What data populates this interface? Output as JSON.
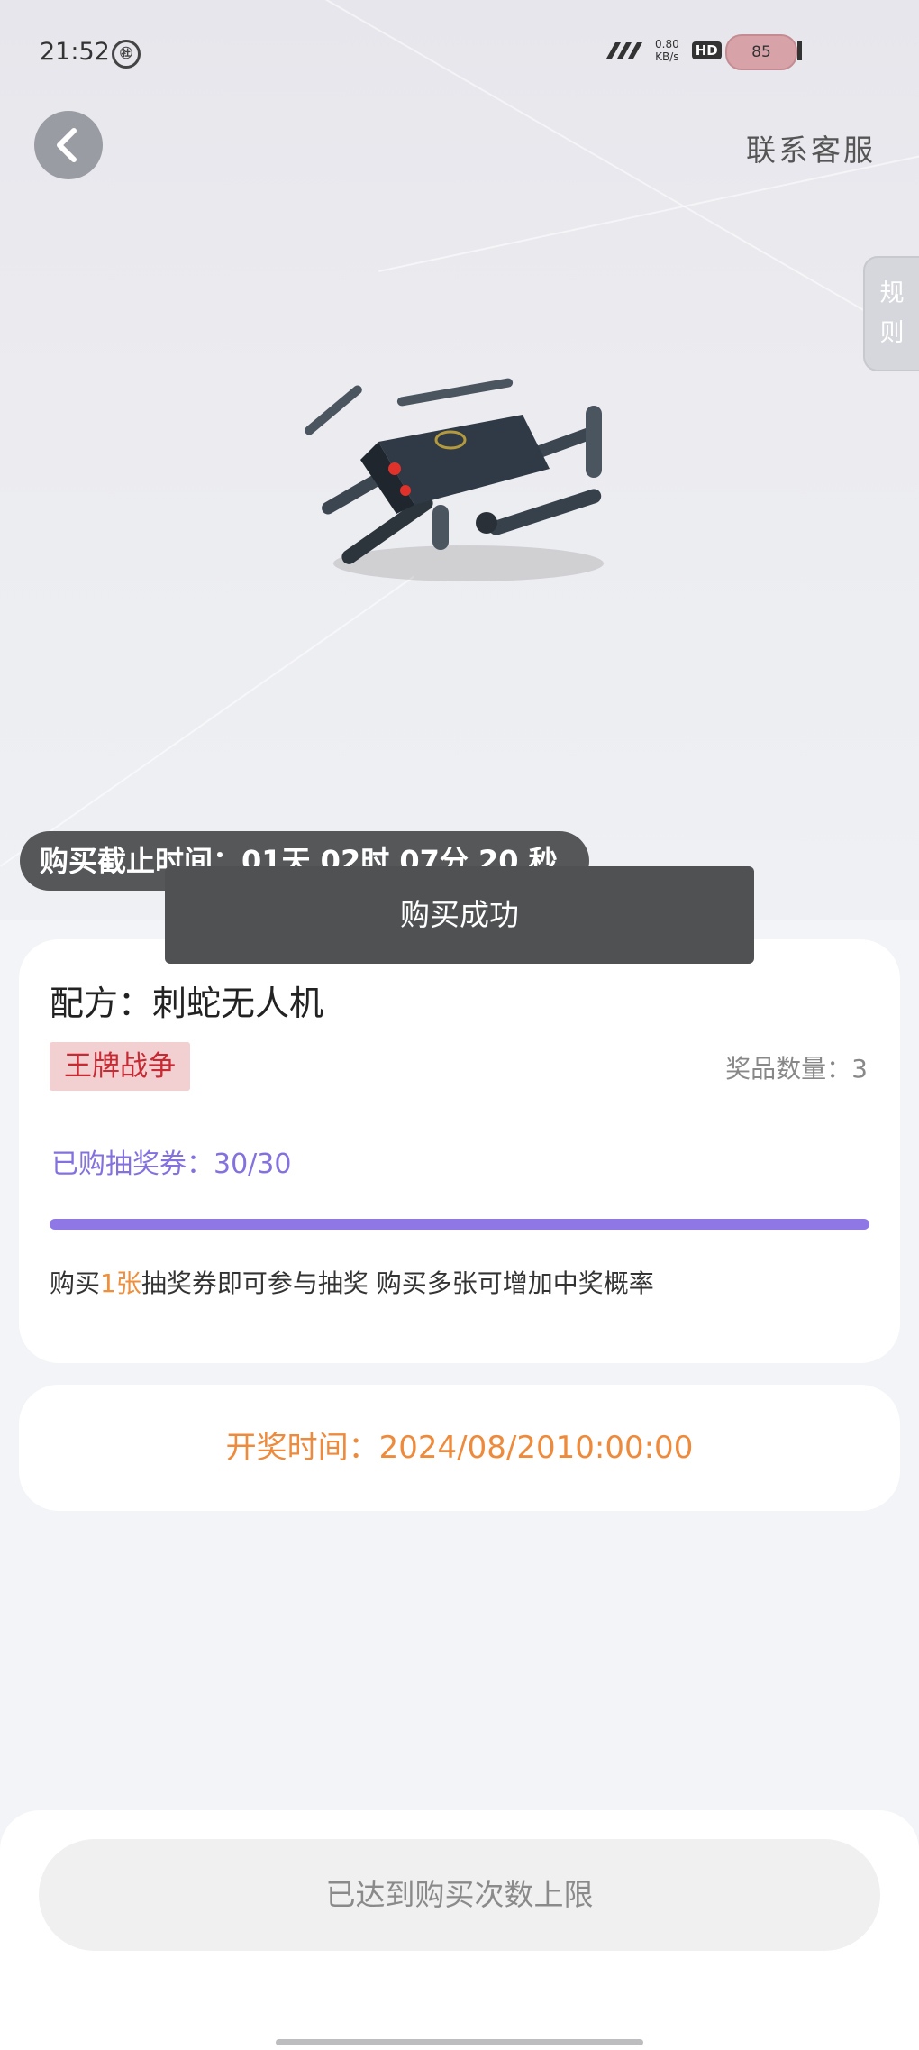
{
  "status_bar": {
    "time": "21:52",
    "notification_badge": "㊓",
    "speed_value": "0.80",
    "speed_unit": "KB/s",
    "hd": "HD",
    "network": "4G",
    "battery": "85"
  },
  "header": {
    "service_label": "联系客服",
    "rules_label_1": "规",
    "rules_label_2": "则"
  },
  "hero": {
    "deadline": "购买截止时间：01天 02时 07分 20 秒"
  },
  "toast": {
    "message": "购买成功"
  },
  "product_card": {
    "recipe": "配方：刺蛇无人机",
    "badge": "王牌战争",
    "prize_count": "奖品数量：3",
    "tickets": "已购抽奖券：30/30",
    "progress_fraction": 1.0,
    "tip_prefix": "购买",
    "tip_highlight": "1张",
    "tip_suffix": "抽奖券即可参与抽奖 购买多张可增加中奖概率"
  },
  "draw_card": {
    "draw_time": "开奖时间：2024/08/2010:00:00"
  },
  "footer": {
    "limit_button": "已达到购买次数上限"
  },
  "icons": {
    "back": "chevron-left-icon",
    "drone": "drone-image"
  },
  "colors": {
    "accent_purple": "#8f78e6",
    "accent_orange": "#ee8a3c",
    "badge_red": "#c72a33"
  }
}
